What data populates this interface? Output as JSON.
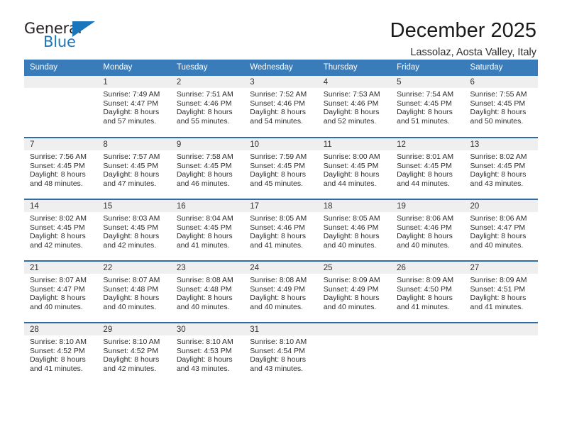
{
  "brand": {
    "name_top": "General",
    "name_bottom": "Blue",
    "accent_color": "#1b75bb"
  },
  "header": {
    "title": "December 2025",
    "subtitle": "Lassolaz, Aosta Valley, Italy"
  },
  "theme": {
    "header_row_bg": "#3a7cb9",
    "week_separator": "#2f6ca5",
    "daynum_bg": "#efefef",
    "text": "#2d2d2d"
  },
  "weekday_headers": [
    "Sunday",
    "Monday",
    "Tuesday",
    "Wednesday",
    "Thursday",
    "Friday",
    "Saturday"
  ],
  "weeks": [
    {
      "days": [
        {
          "number": "",
          "sunrise": "",
          "sunset": "",
          "daylight_line1": "",
          "daylight_line2": "",
          "blank": true
        },
        {
          "number": "1",
          "sunrise": "Sunrise: 7:49 AM",
          "sunset": "Sunset: 4:47 PM",
          "daylight_line1": "Daylight: 8 hours",
          "daylight_line2": "and 57 minutes.",
          "blank": false
        },
        {
          "number": "2",
          "sunrise": "Sunrise: 7:51 AM",
          "sunset": "Sunset: 4:46 PM",
          "daylight_line1": "Daylight: 8 hours",
          "daylight_line2": "and 55 minutes.",
          "blank": false
        },
        {
          "number": "3",
          "sunrise": "Sunrise: 7:52 AM",
          "sunset": "Sunset: 4:46 PM",
          "daylight_line1": "Daylight: 8 hours",
          "daylight_line2": "and 54 minutes.",
          "blank": false
        },
        {
          "number": "4",
          "sunrise": "Sunrise: 7:53 AM",
          "sunset": "Sunset: 4:46 PM",
          "daylight_line1": "Daylight: 8 hours",
          "daylight_line2": "and 52 minutes.",
          "blank": false
        },
        {
          "number": "5",
          "sunrise": "Sunrise: 7:54 AM",
          "sunset": "Sunset: 4:45 PM",
          "daylight_line1": "Daylight: 8 hours",
          "daylight_line2": "and 51 minutes.",
          "blank": false
        },
        {
          "number": "6",
          "sunrise": "Sunrise: 7:55 AM",
          "sunset": "Sunset: 4:45 PM",
          "daylight_line1": "Daylight: 8 hours",
          "daylight_line2": "and 50 minutes.",
          "blank": false
        }
      ]
    },
    {
      "days": [
        {
          "number": "7",
          "sunrise": "Sunrise: 7:56 AM",
          "sunset": "Sunset: 4:45 PM",
          "daylight_line1": "Daylight: 8 hours",
          "daylight_line2": "and 48 minutes.",
          "blank": false
        },
        {
          "number": "8",
          "sunrise": "Sunrise: 7:57 AM",
          "sunset": "Sunset: 4:45 PM",
          "daylight_line1": "Daylight: 8 hours",
          "daylight_line2": "and 47 minutes.",
          "blank": false
        },
        {
          "number": "9",
          "sunrise": "Sunrise: 7:58 AM",
          "sunset": "Sunset: 4:45 PM",
          "daylight_line1": "Daylight: 8 hours",
          "daylight_line2": "and 46 minutes.",
          "blank": false
        },
        {
          "number": "10",
          "sunrise": "Sunrise: 7:59 AM",
          "sunset": "Sunset: 4:45 PM",
          "daylight_line1": "Daylight: 8 hours",
          "daylight_line2": "and 45 minutes.",
          "blank": false
        },
        {
          "number": "11",
          "sunrise": "Sunrise: 8:00 AM",
          "sunset": "Sunset: 4:45 PM",
          "daylight_line1": "Daylight: 8 hours",
          "daylight_line2": "and 44 minutes.",
          "blank": false
        },
        {
          "number": "12",
          "sunrise": "Sunrise: 8:01 AM",
          "sunset": "Sunset: 4:45 PM",
          "daylight_line1": "Daylight: 8 hours",
          "daylight_line2": "and 44 minutes.",
          "blank": false
        },
        {
          "number": "13",
          "sunrise": "Sunrise: 8:02 AM",
          "sunset": "Sunset: 4:45 PM",
          "daylight_line1": "Daylight: 8 hours",
          "daylight_line2": "and 43 minutes.",
          "blank": false
        }
      ]
    },
    {
      "days": [
        {
          "number": "14",
          "sunrise": "Sunrise: 8:02 AM",
          "sunset": "Sunset: 4:45 PM",
          "daylight_line1": "Daylight: 8 hours",
          "daylight_line2": "and 42 minutes.",
          "blank": false
        },
        {
          "number": "15",
          "sunrise": "Sunrise: 8:03 AM",
          "sunset": "Sunset: 4:45 PM",
          "daylight_line1": "Daylight: 8 hours",
          "daylight_line2": "and 42 minutes.",
          "blank": false
        },
        {
          "number": "16",
          "sunrise": "Sunrise: 8:04 AM",
          "sunset": "Sunset: 4:45 PM",
          "daylight_line1": "Daylight: 8 hours",
          "daylight_line2": "and 41 minutes.",
          "blank": false
        },
        {
          "number": "17",
          "sunrise": "Sunrise: 8:05 AM",
          "sunset": "Sunset: 4:46 PM",
          "daylight_line1": "Daylight: 8 hours",
          "daylight_line2": "and 41 minutes.",
          "blank": false
        },
        {
          "number": "18",
          "sunrise": "Sunrise: 8:05 AM",
          "sunset": "Sunset: 4:46 PM",
          "daylight_line1": "Daylight: 8 hours",
          "daylight_line2": "and 40 minutes.",
          "blank": false
        },
        {
          "number": "19",
          "sunrise": "Sunrise: 8:06 AM",
          "sunset": "Sunset: 4:46 PM",
          "daylight_line1": "Daylight: 8 hours",
          "daylight_line2": "and 40 minutes.",
          "blank": false
        },
        {
          "number": "20",
          "sunrise": "Sunrise: 8:06 AM",
          "sunset": "Sunset: 4:47 PM",
          "daylight_line1": "Daylight: 8 hours",
          "daylight_line2": "and 40 minutes.",
          "blank": false
        }
      ]
    },
    {
      "days": [
        {
          "number": "21",
          "sunrise": "Sunrise: 8:07 AM",
          "sunset": "Sunset: 4:47 PM",
          "daylight_line1": "Daylight: 8 hours",
          "daylight_line2": "and 40 minutes.",
          "blank": false
        },
        {
          "number": "22",
          "sunrise": "Sunrise: 8:07 AM",
          "sunset": "Sunset: 4:48 PM",
          "daylight_line1": "Daylight: 8 hours",
          "daylight_line2": "and 40 minutes.",
          "blank": false
        },
        {
          "number": "23",
          "sunrise": "Sunrise: 8:08 AM",
          "sunset": "Sunset: 4:48 PM",
          "daylight_line1": "Daylight: 8 hours",
          "daylight_line2": "and 40 minutes.",
          "blank": false
        },
        {
          "number": "24",
          "sunrise": "Sunrise: 8:08 AM",
          "sunset": "Sunset: 4:49 PM",
          "daylight_line1": "Daylight: 8 hours",
          "daylight_line2": "and 40 minutes.",
          "blank": false
        },
        {
          "number": "25",
          "sunrise": "Sunrise: 8:09 AM",
          "sunset": "Sunset: 4:49 PM",
          "daylight_line1": "Daylight: 8 hours",
          "daylight_line2": "and 40 minutes.",
          "blank": false
        },
        {
          "number": "26",
          "sunrise": "Sunrise: 8:09 AM",
          "sunset": "Sunset: 4:50 PM",
          "daylight_line1": "Daylight: 8 hours",
          "daylight_line2": "and 41 minutes.",
          "blank": false
        },
        {
          "number": "27",
          "sunrise": "Sunrise: 8:09 AM",
          "sunset": "Sunset: 4:51 PM",
          "daylight_line1": "Daylight: 8 hours",
          "daylight_line2": "and 41 minutes.",
          "blank": false
        }
      ]
    },
    {
      "days": [
        {
          "number": "28",
          "sunrise": "Sunrise: 8:10 AM",
          "sunset": "Sunset: 4:52 PM",
          "daylight_line1": "Daylight: 8 hours",
          "daylight_line2": "and 41 minutes.",
          "blank": false
        },
        {
          "number": "29",
          "sunrise": "Sunrise: 8:10 AM",
          "sunset": "Sunset: 4:52 PM",
          "daylight_line1": "Daylight: 8 hours",
          "daylight_line2": "and 42 minutes.",
          "blank": false
        },
        {
          "number": "30",
          "sunrise": "Sunrise: 8:10 AM",
          "sunset": "Sunset: 4:53 PM",
          "daylight_line1": "Daylight: 8 hours",
          "daylight_line2": "and 43 minutes.",
          "blank": false
        },
        {
          "number": "31",
          "sunrise": "Sunrise: 8:10 AM",
          "sunset": "Sunset: 4:54 PM",
          "daylight_line1": "Daylight: 8 hours",
          "daylight_line2": "and 43 minutes.",
          "blank": false
        },
        {
          "number": "",
          "sunrise": "",
          "sunset": "",
          "daylight_line1": "",
          "daylight_line2": "",
          "blank": true
        },
        {
          "number": "",
          "sunrise": "",
          "sunset": "",
          "daylight_line1": "",
          "daylight_line2": "",
          "blank": true
        },
        {
          "number": "",
          "sunrise": "",
          "sunset": "",
          "daylight_line1": "",
          "daylight_line2": "",
          "blank": true
        }
      ]
    }
  ]
}
